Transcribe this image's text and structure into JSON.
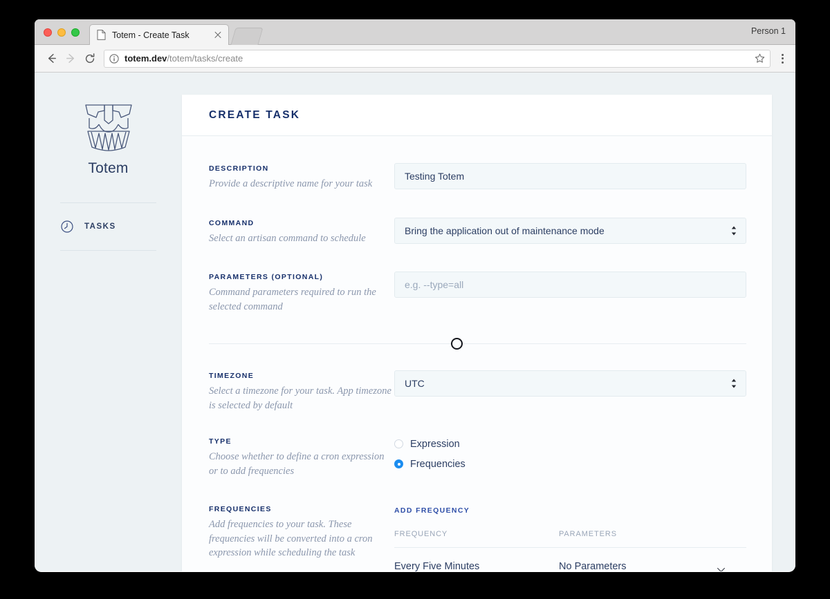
{
  "browser": {
    "tab": {
      "title": "Totem - Create Task",
      "favicon_icon": "document-icon",
      "close_icon": "close-icon"
    },
    "profile_label": "Person 1",
    "toolbar": {
      "back_icon": "arrow-left-icon",
      "forward_icon": "arrow-right-icon",
      "reload_icon": "reload-icon",
      "info_icon": "info-circle-icon",
      "url_host": "totem.dev",
      "url_path": "/totem/tasks/create",
      "bookmark_icon": "star-icon",
      "menu_icon": "three-dots-vertical-icon"
    }
  },
  "sidebar": {
    "logo_icon": "totem-mask-icon",
    "brand": "Totem",
    "nav": [
      {
        "label": "TASKS",
        "icon": "clock-icon"
      }
    ]
  },
  "card": {
    "title": "CREATE TASK",
    "fields": {
      "description": {
        "label": "DESCRIPTION",
        "hint": "Provide a descriptive name for your task",
        "value": "Testing Totem"
      },
      "command": {
        "label": "COMMAND",
        "hint": "Select an artisan command to schedule",
        "value": "Bring the application out of maintenance mode",
        "select_icon": "up-down-arrows-icon"
      },
      "parameters": {
        "label": "PARAMETERS (OPTIONAL)",
        "hint": "Command parameters required to run the selected command",
        "value": "",
        "placeholder": "e.g. --type=all"
      },
      "timezone": {
        "label": "TIMEZONE",
        "hint": "Select a timezone for your task. App timezone is selected by default",
        "value": "UTC",
        "select_icon": "up-down-arrows-icon"
      },
      "type": {
        "label": "TYPE",
        "hint": "Choose whether to define a cron expression or to add frequencies",
        "options": [
          {
            "label": "Expression",
            "selected": false
          },
          {
            "label": "Frequencies",
            "selected": true
          }
        ]
      },
      "frequencies": {
        "label": "FREQUENCIES",
        "hint": "Add frequencies to your task. These frequencies will be converted into a cron expression while scheduling the task",
        "add_link": "ADD FREQUENCY",
        "columns": [
          "FREQUENCY",
          "PARAMETERS"
        ],
        "rows": [
          {
            "frequency": "Every Five Minutes",
            "parameters": "No Parameters",
            "remove_icon": "close-icon"
          }
        ]
      }
    },
    "divider_knob_icon": "circle-outline-icon"
  },
  "colors": {
    "accent_navy": "#17306b",
    "radio_blue": "#1b8df0",
    "page_bg": "#edf2f4",
    "field_bg": "#f3f8fa",
    "hint_text": "#8b97ad"
  }
}
